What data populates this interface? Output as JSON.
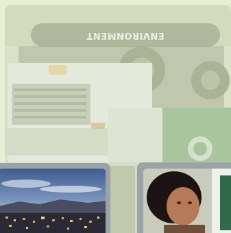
{
  "banner": {
    "label": "ENVIRONMENT"
  },
  "tiles": {
    "main": {
      "icon": "truck-photo"
    },
    "city": {
      "icon": "city-night-photo"
    },
    "person": {
      "icon": "person-photo"
    }
  },
  "colors": {
    "background": "#e6efd4",
    "tile_frame": "#9aa3a6",
    "banner_fill": "#646e58"
  }
}
